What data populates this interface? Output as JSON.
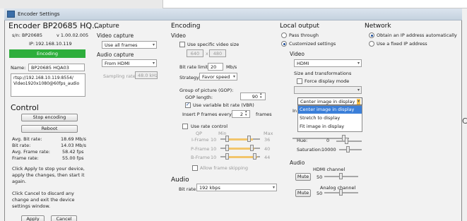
{
  "window": {
    "title": "Encoder Settings"
  },
  "device": {
    "heading": "Encoder BP20685 HQ...",
    "sn_label": "s/n: BP20685",
    "version": "v 1.00.02.005",
    "ip_label": "IP:",
    "ip_value": "192.168.10.119",
    "status_badge": "Encoding",
    "name_label": "Name:",
    "name_value": "BP20685 HQA03",
    "stream_url": "rtsp://192.168.10.119:8554/\nVideo1920x1080@60fps_audio",
    "status_color": "#2eae3c"
  },
  "control": {
    "heading": "Control",
    "stop_label": "Stop encoding",
    "reboot_label": "Reboot",
    "stats": [
      {
        "label": "Avg. Bit rate:",
        "value": "18.69 Mb/s"
      },
      {
        "label": "Bit rate:",
        "value": "14.03 Mb/s"
      },
      {
        "label": "Avg. Frame rate:",
        "value": "58.42 fps"
      },
      {
        "label": "Frame rate:",
        "value": "55.00 fps"
      }
    ],
    "note_apply": "Click Apply to stop your device, apply the changes, then start it again.",
    "note_cancel": "Click Cancel to discard any change and exit the device settings window.",
    "apply_label": "Apply",
    "cancel_label": "Cancel"
  },
  "capture": {
    "heading": "Capture",
    "video_label": "Video capture",
    "video_value": "Use all frames",
    "audio_label": "Audio capture",
    "audio_value": "From HDMI",
    "sampling_label": "Sampling rate:",
    "sampling_value": "48.0 kHz"
  },
  "encoding": {
    "heading": "Encoding",
    "video_heading": "Video",
    "specific_size_label": "Use specific video size",
    "width": "640",
    "height": "480",
    "x": "x",
    "bitrate_limit_label": "Bit rate limit:",
    "bitrate_limit_value": "20",
    "bitrate_unit": "Mb/s",
    "strategy_label": "Strategy:",
    "strategy_value": "Favor speed",
    "gop_heading": "Group of picture (GOP):",
    "gop_length_label": "GOP length:",
    "gop_length_value": "90",
    "vbr_label": "Use variable bit rate (VBR)",
    "pframes_label": "Insert P frames every",
    "pframes_value": "2",
    "pframes_unit": "frames",
    "rate_control_label": "Use rate control",
    "qp": "QP",
    "min": "Min",
    "max": "Max",
    "rows": [
      {
        "label": "I-Frame",
        "min": "10",
        "max": "36"
      },
      {
        "label": "P-Frame",
        "min": "10",
        "max": "40"
      },
      {
        "label": "B-Frame",
        "min": "10",
        "max": "44"
      }
    ],
    "allow_skip_label": "Allow frame skipping",
    "audio_heading": "Audio",
    "audio_bitrate_label": "Bit rate:",
    "audio_bitrate_value": "192 kbps"
  },
  "local_output": {
    "heading": "Local output",
    "pass_through": "Pass through",
    "customized": "Customized settings",
    "video_heading": "Video",
    "video_value": "HDMI",
    "size_heading": "Size and transformations",
    "force_display": "Force display mode",
    "combo_value": "Center image in display",
    "dropdown_options": [
      "Center image in display",
      "Stretch to display",
      "Fit image in display"
    ],
    "partial_label": "In",
    "hue_label": "Hue:",
    "hue_value": "0",
    "saturation_label": "Saturation:",
    "saturation_value": "10000",
    "audio_heading": "Audio",
    "hdmi_channel": "HDMI channel",
    "analog_channel": "Analog channel",
    "mute": "Mute",
    "hdmi_value": "50",
    "analog_value": "50"
  },
  "network": {
    "heading": "Network",
    "auto_ip": "Obtain an IP address automatically",
    "fixed_ip": "Use a fixed IP address"
  },
  "outside": {
    "glyph": "C"
  }
}
